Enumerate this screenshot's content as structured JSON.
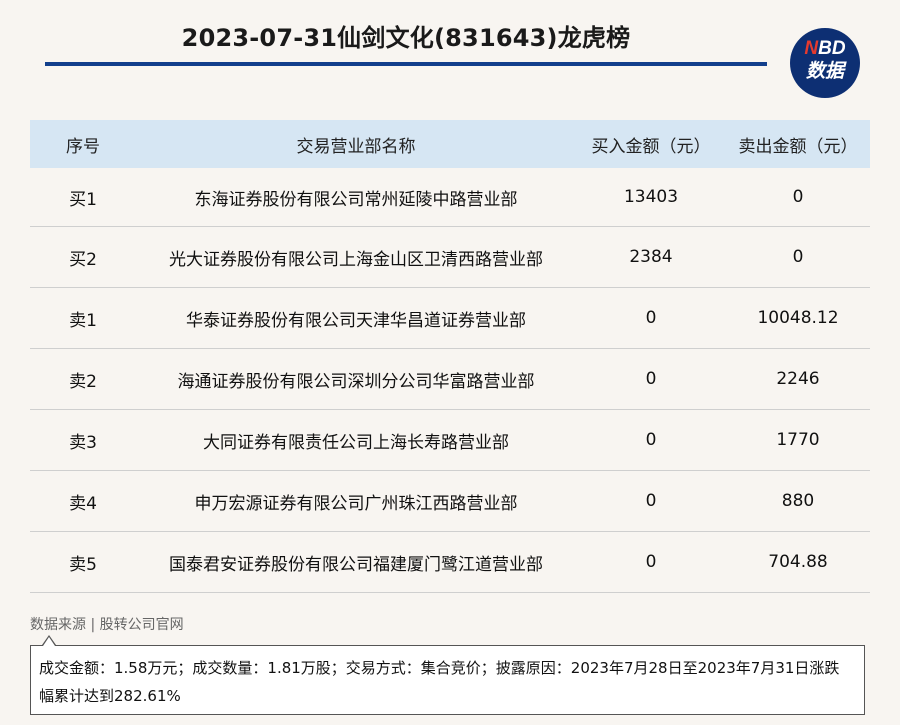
{
  "header": {
    "title": "2023-07-31仙剑文化(831643)龙虎榜",
    "logo_line1_accent": "N",
    "logo_line1_rest": "BD",
    "logo_line2": "数据"
  },
  "table": {
    "columns": [
      "序号",
      "交易营业部名称",
      "买入金额（元）",
      "卖出金额（元）"
    ],
    "rows": [
      {
        "seq": "买1",
        "name": "东海证券股份有限公司常州延陵中路营业部",
        "buy": "13403",
        "sell": "0"
      },
      {
        "seq": "买2",
        "name": "光大证券股份有限公司上海金山区卫清西路营业部",
        "buy": "2384",
        "sell": "0"
      },
      {
        "seq": "卖1",
        "name": "华泰证券股份有限公司天津华昌道证券营业部",
        "buy": "0",
        "sell": "10048.12"
      },
      {
        "seq": "卖2",
        "name": "海通证券股份有限公司深圳分公司华富路营业部",
        "buy": "0",
        "sell": "2246"
      },
      {
        "seq": "卖3",
        "name": "大同证券有限责任公司上海长寿路营业部",
        "buy": "0",
        "sell": "1770"
      },
      {
        "seq": "卖4",
        "name": "申万宏源证券有限公司广州珠江西路营业部",
        "buy": "0",
        "sell": "880"
      },
      {
        "seq": "卖5",
        "name": "国泰君安证券股份有限公司福建厦门鹭江道营业部",
        "buy": "0",
        "sell": "704.88"
      }
    ]
  },
  "footer": {
    "source": "数据来源 | 股转公司官网",
    "note": "成交金额：1.58万元；成交数量：1.81万股；交易方式：集合竞价；披露原因：2023年7月28日至2023年7月31日涨跌幅累计达到282.61%"
  },
  "colors": {
    "accent_rule": "#123f8c",
    "header_row_bg": "#d6e6f3",
    "logo_bg": "#0d2f73",
    "logo_accent": "#e53a2e",
    "page_bg": "#f8f5f1"
  }
}
